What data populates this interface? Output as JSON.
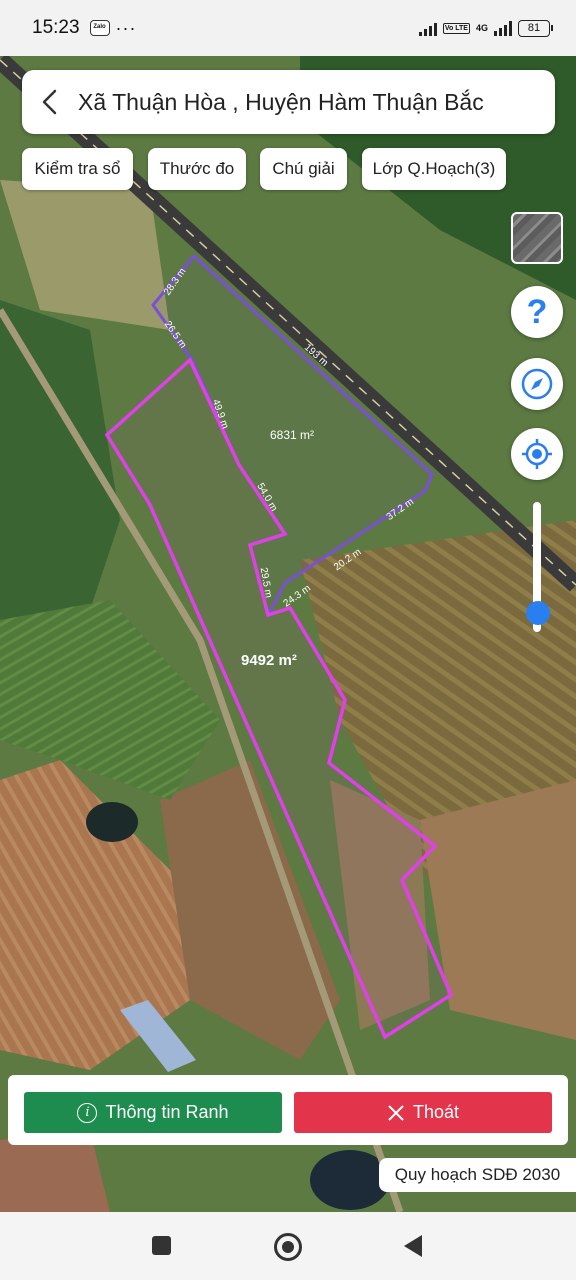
{
  "status_bar": {
    "time": "15:23",
    "app_icon": "zalo-icon",
    "more": "···",
    "volte": "Vo LTE",
    "network": "4G",
    "battery": "81"
  },
  "header": {
    "back_icon": "chevron-left-icon",
    "title": "Xã Thuận Hòa , Huyện Hàm Thuận Bắc"
  },
  "chips": [
    {
      "label": "Kiểm tra sổ"
    },
    {
      "label": "Thước đo"
    },
    {
      "label": "Chú giải"
    },
    {
      "label": "Lớp Q.Hoạch(3)"
    }
  ],
  "controls": {
    "layer_toggle": "satellite-layer-thumbnail",
    "help": "?",
    "compass": "compass-icon",
    "locate": "locate-icon",
    "zoom_level": 0.15
  },
  "map": {
    "parcels": [
      {
        "area": "6831 m²",
        "color": "#7b4fd6"
      },
      {
        "area": "9492 m²",
        "color": "#e040e8"
      }
    ],
    "edge_labels": [
      "28.3 m",
      "26.5 m",
      "193 m",
      "49.9 m",
      "54.0 m",
      "37.2 m",
      "20.2 m",
      "29.5 m",
      "24.3 m"
    ]
  },
  "actions": {
    "info_label": "Thông tin Ranh",
    "exit_label": "Thoát"
  },
  "plan_badge": "Quy hoạch SDĐ 2030",
  "nav": {
    "recents": "recents-icon",
    "home": "home-icon",
    "back": "back-icon"
  }
}
